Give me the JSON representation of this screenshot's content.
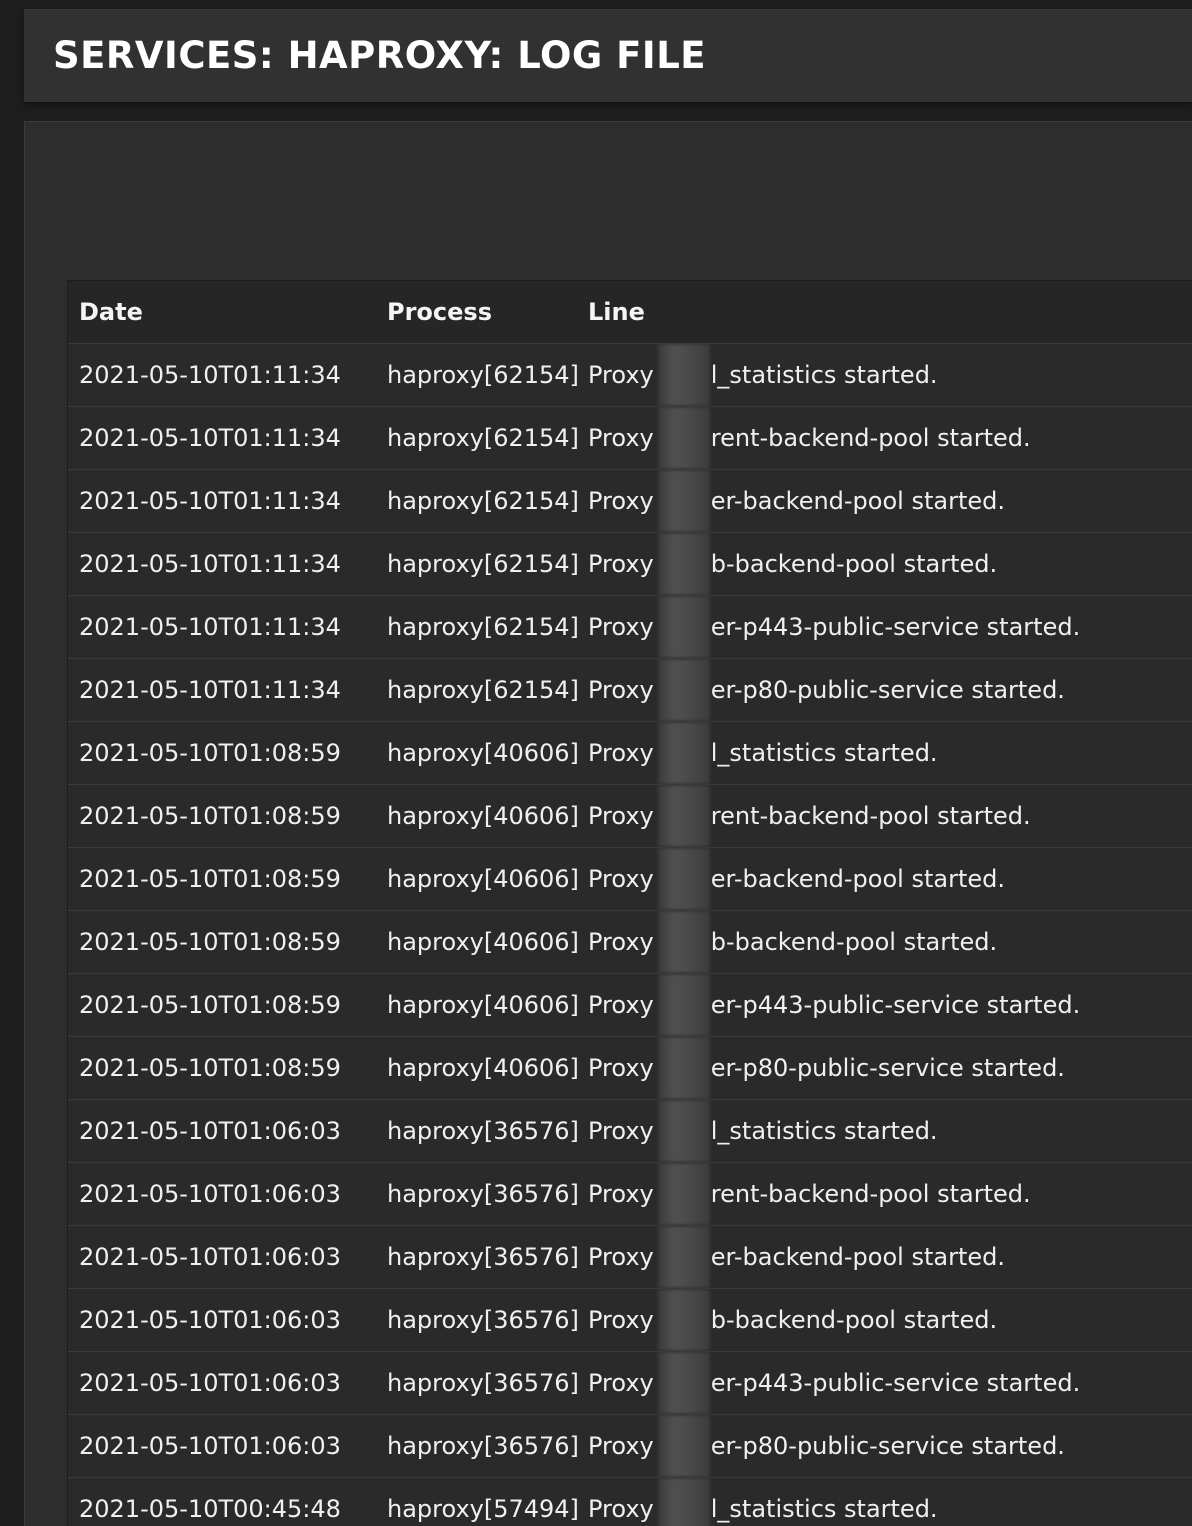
{
  "header": {
    "title": "SERVICES: HAPROXY: LOG FILE"
  },
  "table": {
    "columns": [
      "Date",
      "Process",
      "Line"
    ],
    "rows": [
      {
        "date": "2021-05-10T01:11:34",
        "process": "haproxy[62154]",
        "prefix": "Proxy",
        "suffix": "l_statistics started."
      },
      {
        "date": "2021-05-10T01:11:34",
        "process": "haproxy[62154]",
        "prefix": "Proxy",
        "suffix": "rent-backend-pool started."
      },
      {
        "date": "2021-05-10T01:11:34",
        "process": "haproxy[62154]",
        "prefix": "Proxy",
        "suffix": "er-backend-pool started."
      },
      {
        "date": "2021-05-10T01:11:34",
        "process": "haproxy[62154]",
        "prefix": "Proxy",
        "suffix": "b-backend-pool started."
      },
      {
        "date": "2021-05-10T01:11:34",
        "process": "haproxy[62154]",
        "prefix": "Proxy",
        "suffix": "er-p443-public-service started."
      },
      {
        "date": "2021-05-10T01:11:34",
        "process": "haproxy[62154]",
        "prefix": "Proxy",
        "suffix": "er-p80-public-service started."
      },
      {
        "date": "2021-05-10T01:08:59",
        "process": "haproxy[40606]",
        "prefix": "Proxy",
        "suffix": "l_statistics started."
      },
      {
        "date": "2021-05-10T01:08:59",
        "process": "haproxy[40606]",
        "prefix": "Proxy",
        "suffix": "rent-backend-pool started."
      },
      {
        "date": "2021-05-10T01:08:59",
        "process": "haproxy[40606]",
        "prefix": "Proxy",
        "suffix": "er-backend-pool started."
      },
      {
        "date": "2021-05-10T01:08:59",
        "process": "haproxy[40606]",
        "prefix": "Proxy",
        "suffix": "b-backend-pool started."
      },
      {
        "date": "2021-05-10T01:08:59",
        "process": "haproxy[40606]",
        "prefix": "Proxy",
        "suffix": "er-p443-public-service started."
      },
      {
        "date": "2021-05-10T01:08:59",
        "process": "haproxy[40606]",
        "prefix": "Proxy",
        "suffix": "er-p80-public-service started."
      },
      {
        "date": "2021-05-10T01:06:03",
        "process": "haproxy[36576]",
        "prefix": "Proxy",
        "suffix": "l_statistics started."
      },
      {
        "date": "2021-05-10T01:06:03",
        "process": "haproxy[36576]",
        "prefix": "Proxy",
        "suffix": "rent-backend-pool started."
      },
      {
        "date": "2021-05-10T01:06:03",
        "process": "haproxy[36576]",
        "prefix": "Proxy",
        "suffix": "er-backend-pool started."
      },
      {
        "date": "2021-05-10T01:06:03",
        "process": "haproxy[36576]",
        "prefix": "Proxy",
        "suffix": "b-backend-pool started."
      },
      {
        "date": "2021-05-10T01:06:03",
        "process": "haproxy[36576]",
        "prefix": "Proxy",
        "suffix": "er-p443-public-service started."
      },
      {
        "date": "2021-05-10T01:06:03",
        "process": "haproxy[36576]",
        "prefix": "Proxy",
        "suffix": "er-p80-public-service started."
      },
      {
        "date": "2021-05-10T00:45:48",
        "process": "haproxy[57494]",
        "prefix": "Proxy",
        "suffix": "l_statistics started."
      }
    ]
  }
}
